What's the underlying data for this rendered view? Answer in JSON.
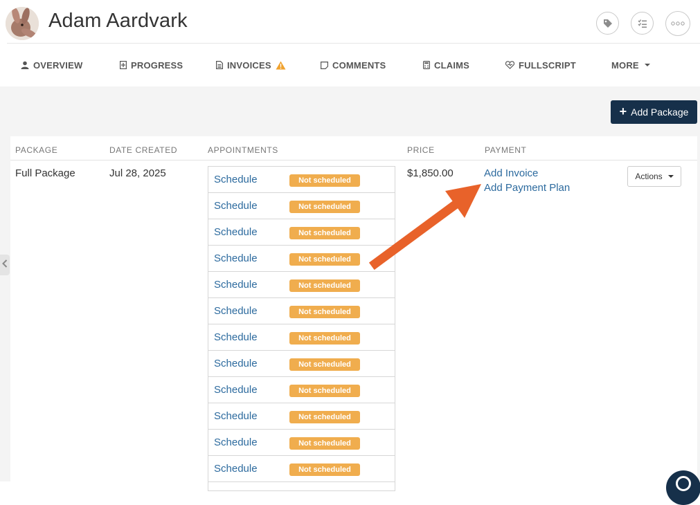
{
  "patient": {
    "name": "Adam Aardvark"
  },
  "header_actions": [
    {
      "icon": "tag-icon"
    },
    {
      "icon": "checklist-icon"
    },
    {
      "icon": "more-dots-icon"
    }
  ],
  "tabs": [
    {
      "label": "OVERVIEW",
      "icon": "user-icon"
    },
    {
      "label": "PROGRESS",
      "icon": "progress-doc-icon"
    },
    {
      "label": "INVOICES",
      "icon": "invoice-doc-icon",
      "warning": true
    },
    {
      "label": "COMMENTS",
      "icon": "comment-icon"
    },
    {
      "label": "CLAIMS",
      "icon": "calculator-icon"
    },
    {
      "label": "FULLSCRIPT",
      "icon": "heart-icon"
    },
    {
      "label": "MORE",
      "icon": "caret-down-icon"
    }
  ],
  "toolbar": {
    "add_package_label": "Add Package"
  },
  "table": {
    "headers": [
      "PACKAGE",
      "DATE CREATED",
      "APPOINTMENTS",
      "PRICE",
      "PAYMENT"
    ],
    "row": {
      "package": "Full Package",
      "date_created": "Jul 28, 2025",
      "price": "$1,850.00",
      "payment_links": [
        "Add Invoice",
        "Add Payment Plan"
      ],
      "actions_label": "Actions"
    },
    "appointments": [
      {
        "link": "Schedule",
        "status": "Not scheduled"
      },
      {
        "link": "Schedule",
        "status": "Not scheduled"
      },
      {
        "link": "Schedule",
        "status": "Not scheduled"
      },
      {
        "link": "Schedule",
        "status": "Not scheduled"
      },
      {
        "link": "Schedule",
        "status": "Not scheduled"
      },
      {
        "link": "Schedule",
        "status": "Not scheduled"
      },
      {
        "link": "Schedule",
        "status": "Not scheduled"
      },
      {
        "link": "Schedule",
        "status": "Not scheduled"
      },
      {
        "link": "Schedule",
        "status": "Not scheduled"
      },
      {
        "link": "Schedule",
        "status": "Not scheduled"
      },
      {
        "link": "Schedule",
        "status": "Not scheduled"
      },
      {
        "link": "Schedule",
        "status": "Not scheduled"
      }
    ]
  },
  "colors": {
    "primary": "#16304a",
    "link": "#2c6a9e",
    "badge": "#f0ad4e",
    "warning": "#f0a22e",
    "annotation_arrow": "#e8622a"
  }
}
